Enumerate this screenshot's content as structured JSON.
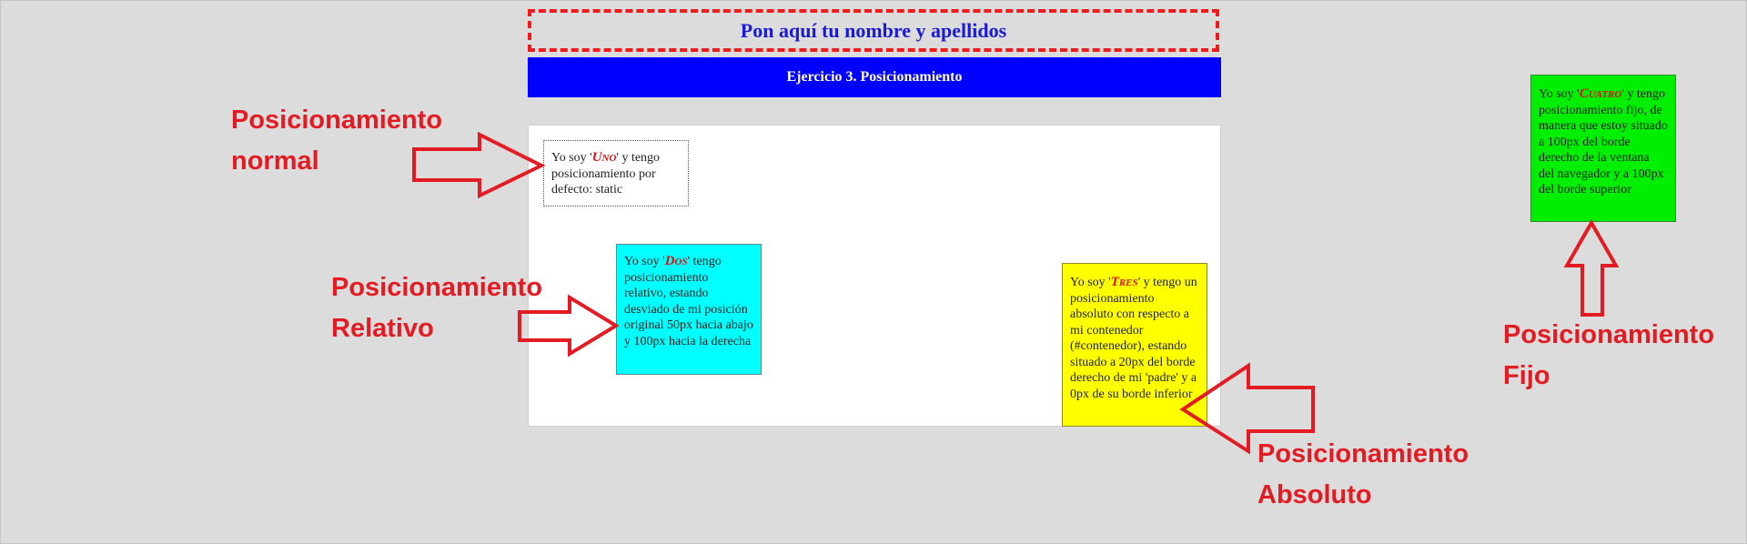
{
  "header": {
    "name_placeholder": "Pon aquí tu nombre y apellidos",
    "exercise_title": "Ejercicio 3. Posicionamiento"
  },
  "boxes": {
    "uno": {
      "prefix": "Yo soy '",
      "name": "Uno",
      "suffix": "' y tengo posicionamiento por defecto: static"
    },
    "dos": {
      "prefix": "Yo soy '",
      "name": "Dos",
      "suffix": "' tengo posicionamiento relativo, estando desviado de mi posición original 50px hacia abajo y 100px hacia la derecha"
    },
    "tres": {
      "prefix": "Yo soy '",
      "name": "Tres",
      "suffix": "' y tengo un posicionamiento absoluto con respecto a mi contenedor (#contenedor), estando situado a 20px del borde derecho de mi 'padre' y a 0px de su borde inferior"
    },
    "cuatro": {
      "prefix": "Yo soy '",
      "name": "Cuatro",
      "suffix": "' y tengo posicionamiento fijo, de manera que estoy situado a 100px del borde derecho de la ventana del navegador y a 100px del borde superior"
    }
  },
  "annotations": {
    "normal": [
      "Posicionamiento",
      "normal"
    ],
    "relativo": [
      "Posicionamiento",
      "Relativo"
    ],
    "absoluto": [
      "Posicionamiento",
      "Absoluto"
    ],
    "fijo": [
      "Posicionamiento",
      "Fijo"
    ]
  },
  "colors": {
    "annotation_red": "#e31c23",
    "uno_bg": "#ffffff",
    "dos_bg": "#00ffff",
    "tres_bg": "#ffff00",
    "cuatro_bg": "#00ee00",
    "header_blue": "#0000ff"
  },
  "icons": {
    "annotation_arrows": [
      "arrow-right-icon",
      "arrow-right-icon",
      "arrow-left-icon",
      "arrow-up-icon"
    ]
  }
}
